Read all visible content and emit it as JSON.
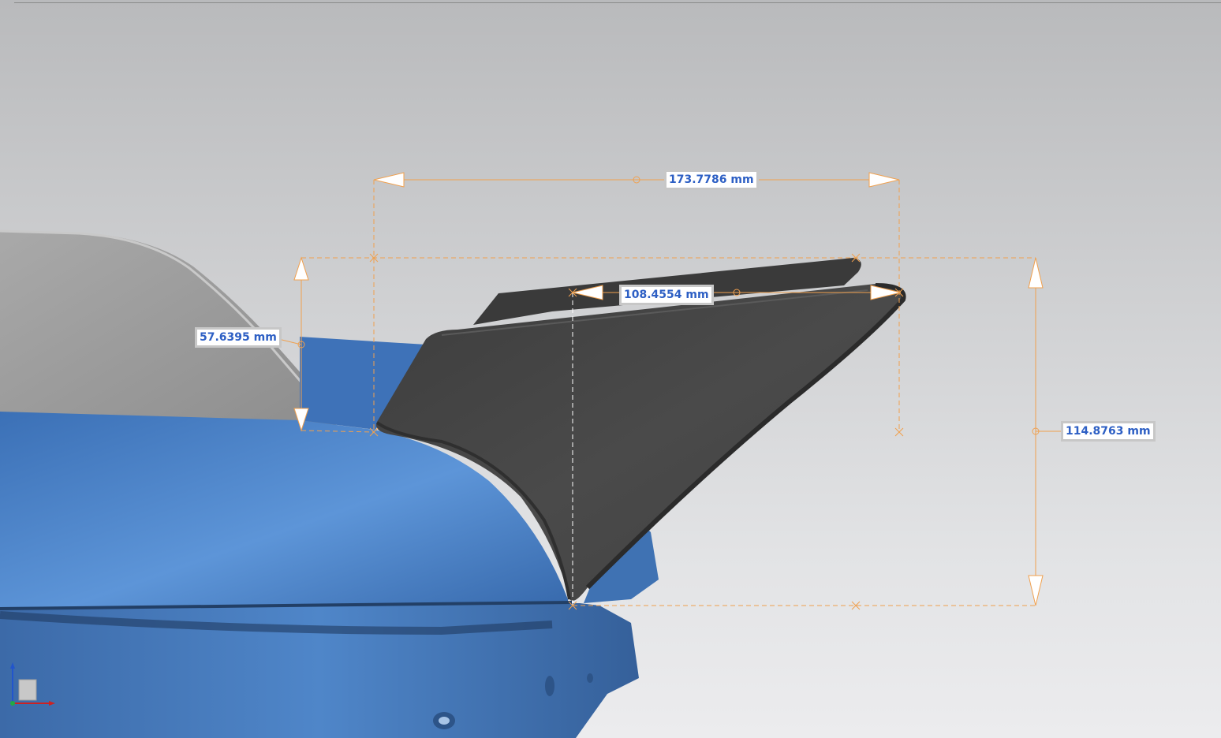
{
  "viewport": {
    "background_top": "#b9babc",
    "background_bottom": "#ececee"
  },
  "colors": {
    "dimension_line": "#f0a04e",
    "dimension_text": "#2d5fc4",
    "body_blue": "#4a82c6",
    "part_dark": "#454545",
    "body_gray": "#9a9a9a"
  },
  "dimensions": {
    "width_total": "173.7786 mm",
    "width_top": "108.4554 mm",
    "height_left": "57.6395 mm",
    "height_total": "114.8763 mm"
  },
  "triad": {
    "axes": [
      "z-axis",
      "x-axis",
      "y-axis"
    ]
  }
}
